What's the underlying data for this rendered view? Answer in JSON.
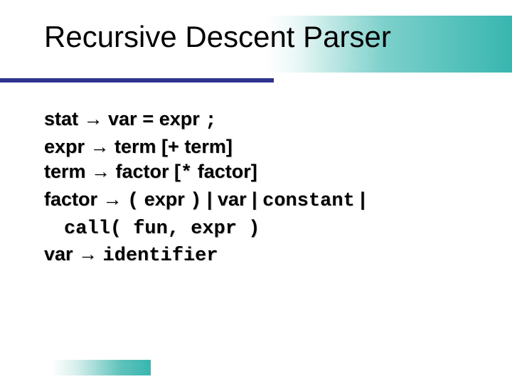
{
  "slide": {
    "title": "Recursive Descent Parser",
    "grammar": {
      "line1_a": "stat → var ",
      "line1_b": "=",
      "line1_c": " expr ",
      "line1_d": ";",
      "line2": "expr → term [+ term]",
      "line3_a": "term → factor [",
      "line3_b": "*",
      "line3_c": " factor]",
      "line4_a": "factor → ",
      "line4_b": "(",
      "line4_c": " expr ",
      "line4_d": ")",
      "line4_e": " | var | ",
      "line4_f": "constant",
      "line4_g": " |",
      "line5_a": "call( fun, expr )",
      "line6_a": "var → ",
      "line6_b": "identifier"
    }
  }
}
